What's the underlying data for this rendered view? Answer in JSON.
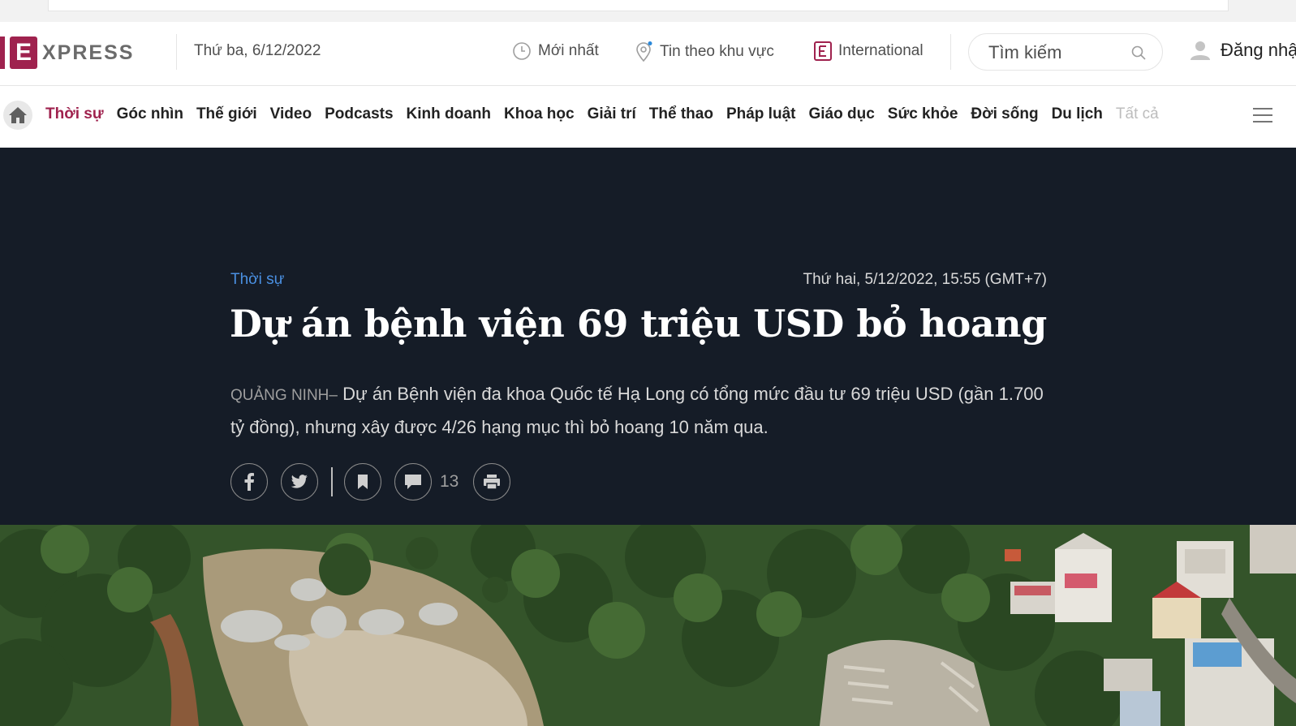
{
  "header": {
    "logo_letter": "E",
    "logo_word": "XPRESS",
    "date": "Thứ ba, 6/12/2022",
    "links": {
      "latest": "Mới nhất",
      "regional": "Tin theo khu vực",
      "international": "International"
    },
    "search": {
      "placeholder": "Tìm kiếm"
    },
    "login": "Đăng nhập"
  },
  "nav": {
    "items": [
      "Thời sự",
      "Góc nhìn",
      "Thế giới",
      "Video",
      "Podcasts",
      "Kinh doanh",
      "Khoa học",
      "Giải trí",
      "Thể thao",
      "Pháp luật",
      "Giáo dục",
      "Sức khỏe",
      "Đời sống",
      "Du lịch"
    ],
    "all": "Tất cả"
  },
  "article": {
    "category": "Thời sự",
    "timestamp": "Thứ hai, 5/12/2022, 15:55 (GMT+7)",
    "title": "Dự án bệnh viện 69 triệu USD bỏ hoang",
    "location": "QUẢNG NINH–",
    "description": "Dự án Bệnh viện đa khoa Quốc tế Hạ Long có tổng mức đầu tư 69 triệu USD (gần 1.700 tỷ đồng), nhưng xây được 4/26 hạng mục thì bỏ hoang 10 năm qua.",
    "comment_count": "13"
  },
  "colors": {
    "brand": "#9f224e",
    "hero_bg": "#151c27",
    "category_link": "#4a90e2"
  }
}
